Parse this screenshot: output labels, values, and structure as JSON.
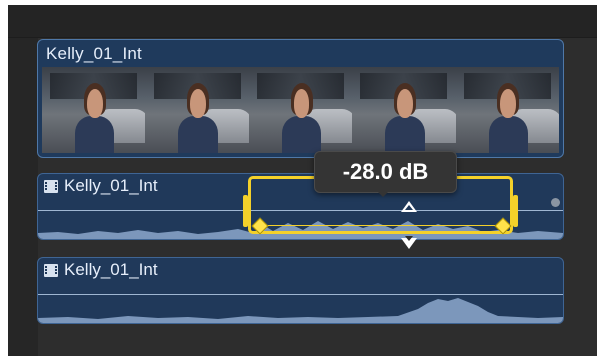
{
  "timeline": {
    "video_clip": {
      "name": "Kelly_01_Int",
      "thumbnails": 5
    },
    "audio_clips": [
      {
        "name": "Kelly_01_Int",
        "selected_range": true
      },
      {
        "name": "Kelly_01_Int",
        "selected_range": false
      }
    ],
    "volume_tooltip": "-28.0 dB",
    "colors": {
      "clip_blue": "#1f3a5c",
      "selection_yellow": "#f4d12a",
      "keyframe_yellow": "#ffe34a",
      "background": "#2b2b2b"
    },
    "icons": [
      "film-icon",
      "keyframe-icon",
      "volume-up-arrow-icon",
      "volume-down-arrow-icon"
    ]
  }
}
